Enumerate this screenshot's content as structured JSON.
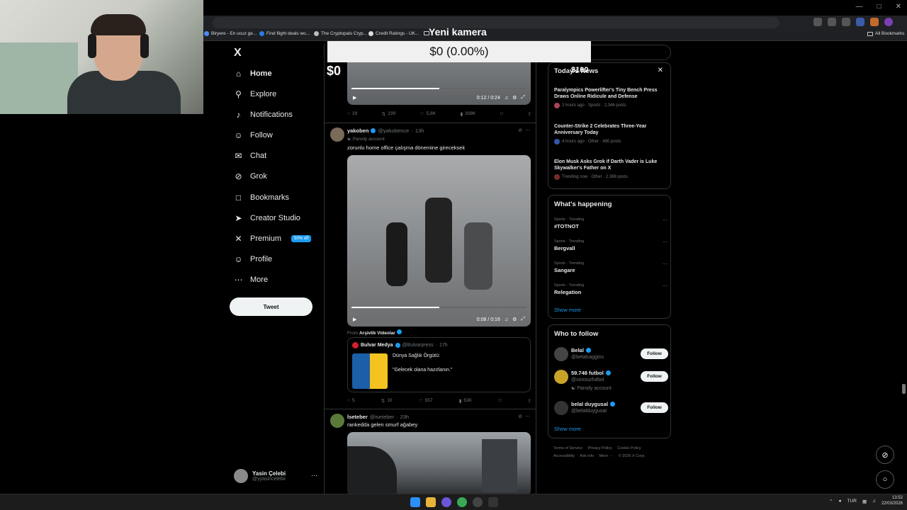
{
  "overlay": {
    "camera_title": "Yeni kamera",
    "box_text": "$0 (0.00%)",
    "dollar_left": "$0",
    "dollar_right": "$100"
  },
  "bookmarks": [
    {
      "label": "Biryere - En ucuz ge..."
    },
    {
      "label": "Find flight deals wo..."
    },
    {
      "label": "The Cryptopals Cryp..."
    },
    {
      "label": "Credit Ratings - UK..."
    },
    {
      "label": "All Bookmarks"
    }
  ],
  "nav": {
    "logo": "X",
    "items": [
      {
        "label": "Home",
        "icon": "home-icon"
      },
      {
        "label": "Explore",
        "icon": "search-icon"
      },
      {
        "label": "Notifications",
        "icon": "bell-icon"
      },
      {
        "label": "Follow",
        "icon": "person-plus-icon"
      },
      {
        "label": "Chat",
        "icon": "mail-icon"
      },
      {
        "label": "Grok",
        "icon": "grok-icon"
      },
      {
        "label": "Bookmarks",
        "icon": "bookmark-icon"
      },
      {
        "label": "Creator Studio",
        "icon": "rocket-icon"
      },
      {
        "label": "Premium",
        "icon": "x-icon"
      },
      {
        "label": "Profile",
        "icon": "person-icon"
      },
      {
        "label": "More",
        "icon": "more-icon"
      }
    ],
    "premium_badge": "50% off",
    "tweet_button": "Tweet",
    "account_name": "Yasin Çelebi",
    "account_handle": "@yyasincelebii"
  },
  "feed": {
    "tweet1": {
      "video_time": "0:12 / 0:24",
      "replies": "29",
      "retweets": "239",
      "likes": "5,8K",
      "views": "308K"
    },
    "tweet2": {
      "name": "yakoben",
      "handle": "@yakobence",
      "time": "13h",
      "tag": "Parody account",
      "text": "zorunlu home office çalışma dönemine gireceksek",
      "video_time": "0:08 / 0:16",
      "from_label": "From",
      "from_source": "Arşivlik Videolar",
      "quote": {
        "name": "Bulvar Medya",
        "handle": "@Bulvarpress",
        "time": "17h",
        "line1": "Dünya Sağlık Örgütü:",
        "line2": "\"Gelecek olana hazırlanın.\""
      },
      "replies": "5",
      "retweets": "10",
      "likes": "557",
      "views": "53K"
    },
    "tweet3": {
      "name": "İseteber",
      "handle": "@iseteber",
      "time": "23h",
      "text": "rankedda gelen smurf ağabey"
    }
  },
  "sidebar": {
    "news_title": "Today's News",
    "news": [
      {
        "title": "Paralympics Powerlifter's Tiny Bench Press Draws Online Ridicule and Defense",
        "meta": "2 hours ago · Sports · 2,346 posts"
      },
      {
        "title": "Counter-Strike 2 Celebrates Three-Year Anniversary Today",
        "meta": "4 hours ago · Other · 480 posts"
      },
      {
        "title": "Elon Musk Asks Grok if Darth Vader is Luke Skywalker's Father on X",
        "meta": "Trending now · Other · 2,388 posts"
      }
    ],
    "happening_title": "What's happening",
    "trends": [
      {
        "category": "Sports · Trending",
        "name": "#TOTNOT"
      },
      {
        "category": "Sports · Trending",
        "name": "Bergvall"
      },
      {
        "category": "Sports · Trending",
        "name": "Sangare"
      },
      {
        "category": "Sports · Trending",
        "name": "Relegation"
      }
    ],
    "show_more": "Show more",
    "follow_title": "Who to follow",
    "follows": [
      {
        "name": "Belal",
        "handle": "@belalcaggins",
        "extra": "",
        "button": "Follow"
      },
      {
        "name": "59.748 futbol",
        "handle": "@sonsuzfutbol",
        "extra": "Parody account",
        "button": "Follow"
      },
      {
        "name": "belal duygusal",
        "handle": "@belalduygusal",
        "extra": "",
        "button": "Follow"
      }
    ],
    "footer": [
      "Terms of Service",
      "Privacy Policy",
      "Cookie Policy",
      "Accessibility",
      "Ads info",
      "More ···",
      "© 2026 X Corp."
    ]
  },
  "taskbar": {
    "lang": "TUR",
    "time": "13:52",
    "date": "22/03/2026"
  }
}
